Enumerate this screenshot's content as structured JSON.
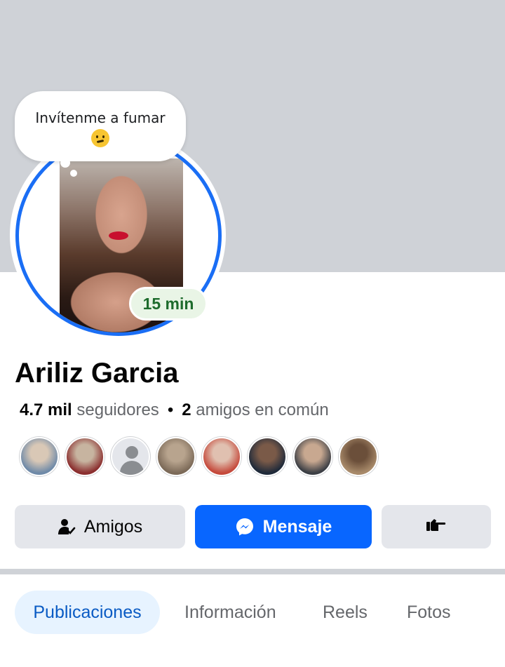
{
  "cover": {},
  "thought_bubble": {
    "text": "Invítenme a fumar",
    "emoji": "confused-face"
  },
  "status": {
    "label": "15 min"
  },
  "profile": {
    "name": "Ariliz Garcia"
  },
  "stats": {
    "followers_count": "4.7 mil",
    "followers_label": "seguidores",
    "separator": "•",
    "mutual_count": "2",
    "mutual_label": "amigos en común"
  },
  "mutual_friends": [
    {
      "colors": [
        "#6f8aa8",
        "#d9c8b6"
      ]
    },
    {
      "colors": [
        "#8b2f2f",
        "#c7b4a0"
      ]
    },
    {
      "colors": [
        "default"
      ]
    },
    {
      "colors": [
        "#7c6a58",
        "#b8a48e"
      ]
    },
    {
      "colors": [
        "#c54a3c",
        "#e0c0b0"
      ]
    },
    {
      "colors": [
        "#1f2a3a",
        "#7a5a48"
      ]
    },
    {
      "colors": [
        "#3c3f45",
        "#c8a890"
      ]
    },
    {
      "colors": [
        "#a88a6a",
        "#6b4f3a"
      ]
    }
  ],
  "actions": {
    "friends_label": "Amigos",
    "message_label": "Mensaje",
    "more_icon": "pointing-hand-icon"
  },
  "tabs": [
    {
      "label": "Publicaciones",
      "active": true
    },
    {
      "label": "Información",
      "active": false
    },
    {
      "label": "Reels",
      "active": false
    },
    {
      "label": "Fotos",
      "active": false
    }
  ],
  "colors": {
    "accent": "#0866ff",
    "status_text": "#1d6b2c",
    "ring": "#1a6ef5"
  }
}
